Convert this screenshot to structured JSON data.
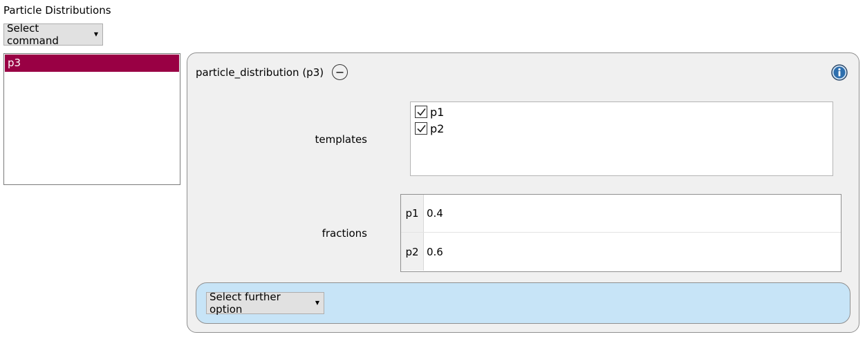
{
  "page_title": "Particle Distributions",
  "command_dropdown": {
    "label": "Select command"
  },
  "object_list": {
    "items": [
      {
        "label": "p3",
        "selected": true
      }
    ]
  },
  "panel": {
    "title": "particle_distribution (p3)",
    "templates": {
      "label": "templates",
      "items": [
        {
          "label": "p1",
          "checked": true
        },
        {
          "label": "p2",
          "checked": true
        }
      ]
    },
    "fractions": {
      "label": "fractions",
      "rows": [
        {
          "key": "p1",
          "value": "0.4"
        },
        {
          "key": "p2",
          "value": "0.6"
        }
      ]
    },
    "further_option": {
      "label": "Select further option"
    }
  },
  "colors": {
    "selection": "#990044",
    "panel_bg": "#f0f0f0",
    "further_bg": "#c7e4f7",
    "info_icon": "#2e6fae"
  },
  "icons": {
    "collapse": "minus-circle-icon",
    "info": "info-icon",
    "dropdown": "caret-down-icon",
    "check": "checkmark-icon"
  }
}
